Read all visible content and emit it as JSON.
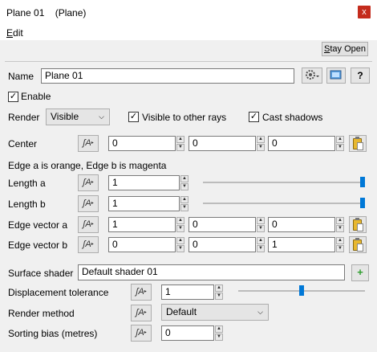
{
  "window": {
    "title": "Plane 01    (Plane)",
    "close_glyph": "x"
  },
  "menu": {
    "edit": "Edit"
  },
  "toolbar": {
    "stay_open": "Stay Open",
    "help": "?"
  },
  "name": {
    "label": "Name",
    "value": "Plane 01"
  },
  "enable": {
    "label": "Enable",
    "checked": true
  },
  "render": {
    "label": "Render",
    "value": "Visible",
    "visible_to_other_rays": {
      "label": "Visible to other rays",
      "checked": true
    },
    "cast_shadows": {
      "label": "Cast shadows",
      "checked": true
    }
  },
  "center": {
    "label": "Center",
    "x": "0",
    "y": "0",
    "z": "0"
  },
  "edge_note": "Edge a is orange, Edge b is magenta",
  "length_a": {
    "label": "Length a",
    "value": "1",
    "slider_fraction": 1.0
  },
  "length_b": {
    "label": "Length b",
    "value": "1",
    "slider_fraction": 1.0
  },
  "edge_vector_a": {
    "label": "Edge vector a",
    "x": "1",
    "y": "0",
    "z": "0"
  },
  "edge_vector_b": {
    "label": "Edge vector b",
    "x": "0",
    "y": "0",
    "z": "1"
  },
  "surface_shader": {
    "label": "Surface shader",
    "value": "Default shader 01",
    "add_glyph": "+"
  },
  "displacement_tolerance": {
    "label": "Displacement tolerance",
    "value": "1",
    "slider_fraction": 0.5
  },
  "render_method": {
    "label": "Render method",
    "value": "Default"
  },
  "sorting_bias": {
    "label": "Sorting bias (metres)",
    "value": "0"
  },
  "glyphs": {
    "check": "✓",
    "chevron": "⌵",
    "fcurve": "ʃA",
    "fcurve_arrow": "▸",
    "spin_up": "▲",
    "spin_down": "▼"
  }
}
